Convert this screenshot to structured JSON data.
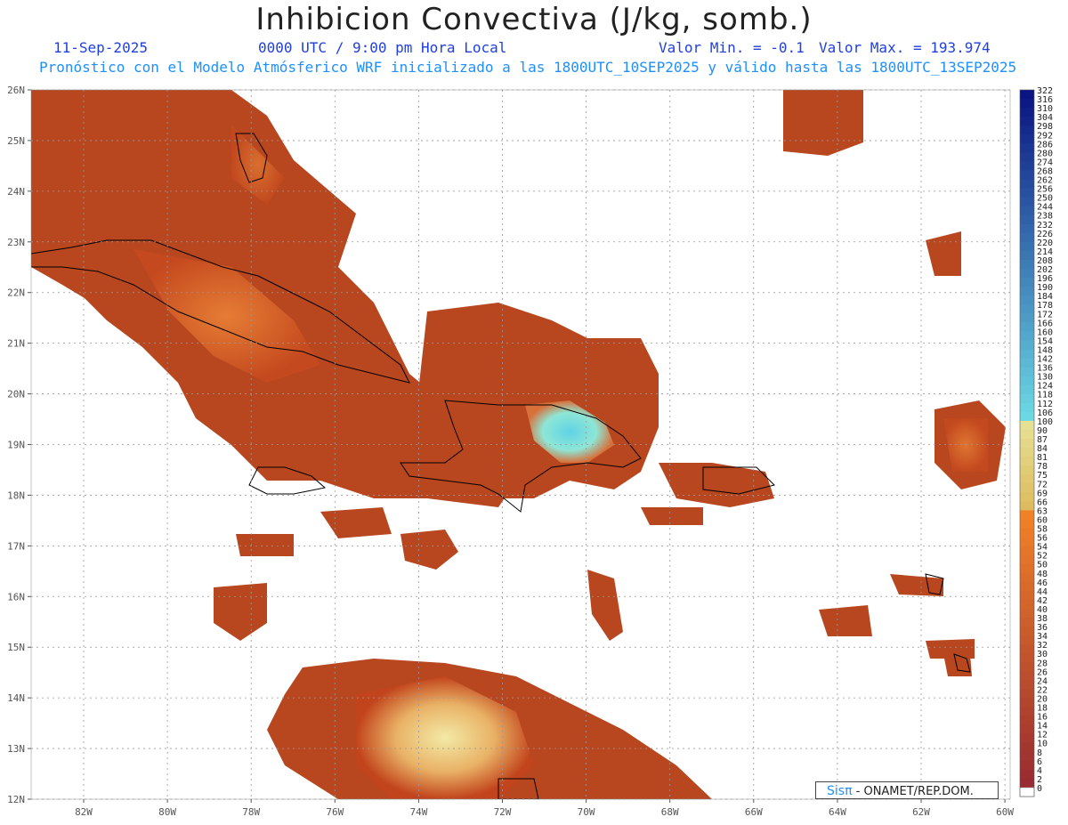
{
  "title": "Inhibicion Convectiva (J/kg, somb.)",
  "date": "11-Sep-2025",
  "time": "0000 UTC / 9:00 pm Hora Local",
  "valmin": "Valor Min. = -0.1",
  "valmax": "Valor Max. = 193.974",
  "forecast": "Pronóstico con el Modelo Atmósferico WRF inicializado a las 1800UTC_10SEP2025 y válido hasta las  1800UTC_13SEP2025",
  "credit": {
    "logo": "Sisπ",
    "text": " - ONAMET/REP.DOM."
  },
  "lat_labels": [
    "26N",
    "25N",
    "24N",
    "23N",
    "22N",
    "21N",
    "20N",
    "19N",
    "18N",
    "17N",
    "16N",
    "15N",
    "14N",
    "13N",
    "12N"
  ],
  "lon_labels": [
    "82W",
    "80W",
    "78W",
    "76W",
    "74W",
    "72W",
    "70W",
    "68W",
    "66W",
    "64W",
    "62W",
    "60W"
  ],
  "colorbar_labels": [
    "322",
    "316",
    "310",
    "304",
    "298",
    "292",
    "286",
    "280",
    "274",
    "268",
    "262",
    "256",
    "250",
    "244",
    "238",
    "232",
    "226",
    "220",
    "214",
    "208",
    "202",
    "196",
    "190",
    "184",
    "178",
    "172",
    "166",
    "160",
    "154",
    "148",
    "142",
    "136",
    "130",
    "124",
    "118",
    "112",
    "106",
    "100",
    "90",
    "87",
    "84",
    "81",
    "78",
    "75",
    "72",
    "69",
    "66",
    "63",
    "60",
    "58",
    "56",
    "54",
    "52",
    "50",
    "48",
    "46",
    "44",
    "42",
    "40",
    "38",
    "36",
    "34",
    "32",
    "30",
    "28",
    "26",
    "24",
    "22",
    "20",
    "18",
    "16",
    "14",
    "12",
    "10",
    "8",
    "6",
    "4",
    "2",
    "0"
  ]
}
